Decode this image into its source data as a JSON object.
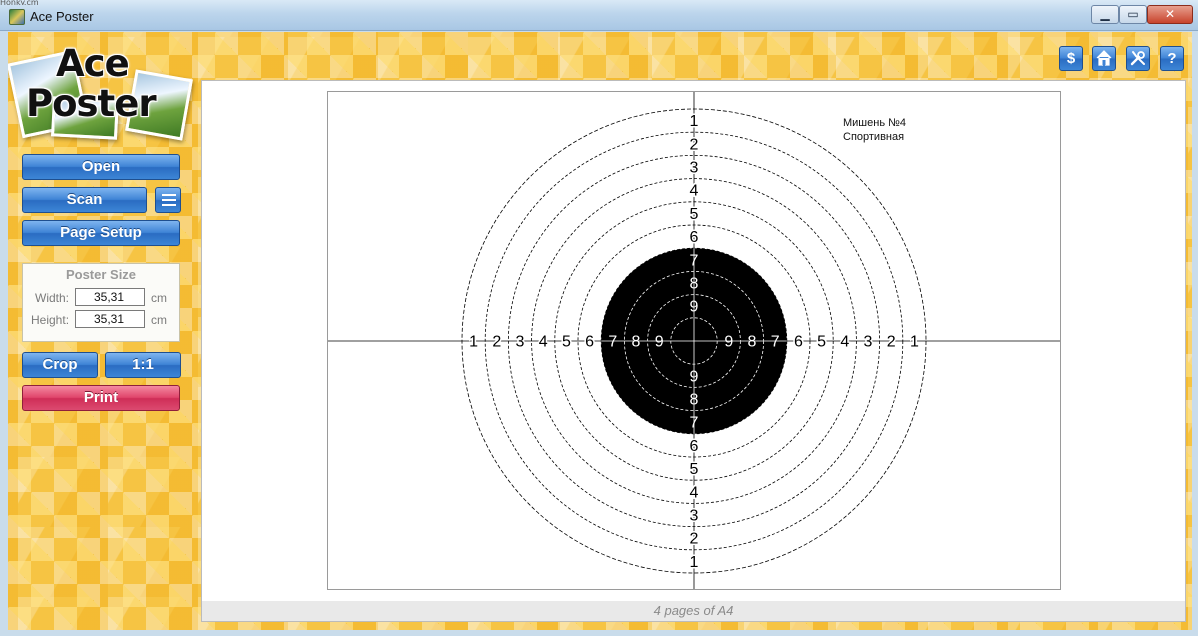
{
  "window": {
    "title": "Ace Poster",
    "top_strip": "Honky.cm"
  },
  "logo": {
    "line1": "Ace",
    "line2": "Poster"
  },
  "buttons": {
    "open": "Open",
    "scan": "Scan",
    "page_setup": "Page Setup",
    "crop": "Crop",
    "one_to_one": "1:1",
    "print": "Print"
  },
  "poster_size": {
    "header": "Poster Size",
    "width_label": "Width:",
    "width_value": "35,31",
    "height_label": "Height:",
    "height_value": "35,31",
    "unit": "cm"
  },
  "toolbar_icons": [
    "dollar-icon",
    "home-icon",
    "tools-icon",
    "help-icon"
  ],
  "toolbar_labels": {
    "dollar": "$",
    "help": "?"
  },
  "target": {
    "caption_line1": "Мишень №4",
    "caption_line2": "Спортивная",
    "ring_numbers": [
      "1",
      "2",
      "3",
      "4",
      "5",
      "6",
      "7",
      "8",
      "9"
    ]
  },
  "status": {
    "pages": "4 pages of A4"
  },
  "colors": {
    "print_button": "#dc4a70",
    "blue_button": "#3f84d6",
    "background": "#f6c443"
  }
}
